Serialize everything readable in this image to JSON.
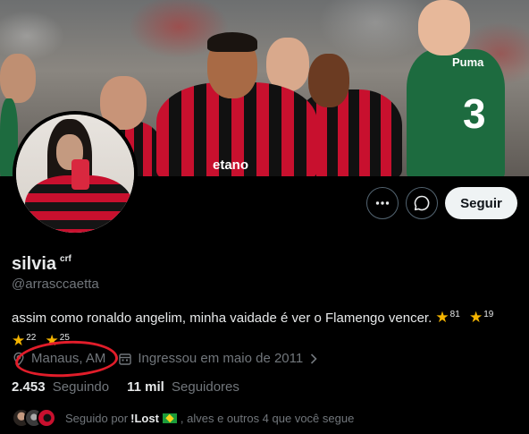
{
  "profile": {
    "name": "silvia",
    "name_suffix": "crf",
    "handle": "@arrasccaetta",
    "bio_text": "assim como ronaldo angelim, minha vaidade é ver o Flamengo vencer.",
    "bio_stars": [
      {
        "icon": "star-icon",
        "sup": "81"
      },
      {
        "icon": "star-icon",
        "sup": "19"
      },
      {
        "icon": "star-icon",
        "sup": "22"
      },
      {
        "icon": "star-icon",
        "sup": "25"
      }
    ],
    "location": "Manaus, AM",
    "joined": "Ingressou em maio de 2011",
    "following_count": "2.453",
    "following_label": "Seguindo",
    "followers_count": "11 mil",
    "followers_label": "Seguidores",
    "followed_by_prefix": "Seguido por",
    "followed_by_name": "!Lost",
    "followed_by_suffix": ", alves e outros 4 que você segue"
  },
  "actions": {
    "follow_label": "Seguir",
    "more_icon": "more-icon",
    "message_icon": "message-icon"
  },
  "banner": {
    "shirt_text": "etano",
    "green_number": "3",
    "green_brand": "Puma"
  },
  "colors": {
    "accent_star": "#f4b400",
    "annotation_red": "#e11d2a",
    "flamengo_red": "#c8102e",
    "palmeiras_green": "#1d6b3f"
  }
}
